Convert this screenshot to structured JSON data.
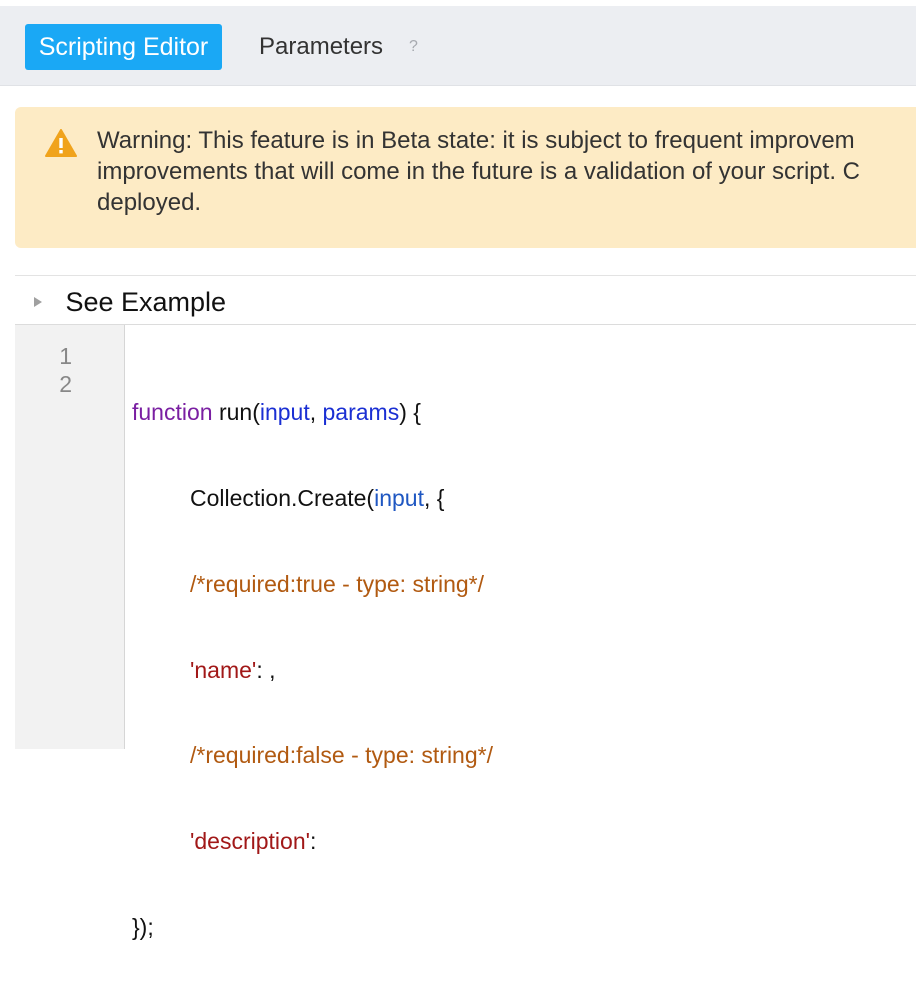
{
  "tabs": {
    "active_label": "Scripting Editor",
    "params_label": "Parameters",
    "help_glyph": "?"
  },
  "warning": {
    "icon": "warning-triangle-icon",
    "lines": [
      "Warning: This feature is in Beta state: it is subject to frequent improvem",
      "improvements that will come in the future is a validation of your script. C",
      "deployed."
    ]
  },
  "example": {
    "label": "See Example",
    "icon": "collapse-triangle-icon"
  },
  "editor": {
    "line_numbers": [
      "1",
      "2"
    ],
    "code": {
      "l1": {
        "kw": "function",
        "a": " run(",
        "v1": "input",
        "b": ", ",
        "v2": "params",
        "c": ") {"
      },
      "l2": {
        "a": "Collection.Create(",
        "v1": "input",
        "b": ", {"
      },
      "l3": {
        "cmt": "/*required:true - type: string*/"
      },
      "l4": {
        "str": "'name'",
        "a": ": ,"
      },
      "l5": {
        "cmt": "/*required:false - type: string*/"
      },
      "l6": {
        "str": "'description'",
        "a": ":"
      },
      "l7": {
        "a": "});"
      }
    }
  },
  "colors": {
    "active_tab": "#1aa8f5",
    "warning_bg": "#fdebc5",
    "warning_icon": "#f0a31c",
    "keyword": "#7a1fa2",
    "variable": "#1a2fd3",
    "comment": "#b15a11",
    "string": "#a11818"
  }
}
